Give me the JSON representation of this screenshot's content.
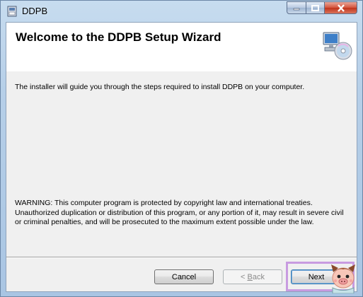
{
  "window": {
    "title": "DDPB"
  },
  "banner": {
    "title": "Welcome to the DDPB Setup Wizard",
    "icon": "computer-cd-icon"
  },
  "body": {
    "intro": "The installer will guide you through the steps required to install DDPB on your computer.",
    "warning": "WARNING: This computer program is protected by copyright law and international treaties. Unauthorized duplication or distribution of this program, or any portion of it, may result in severe civil or criminal penalties, and will be prosecuted to the maximum extent possible under the law."
  },
  "buttons": {
    "cancel": "Cancel",
    "back_prefix": "< ",
    "back_accel": "B",
    "back_rest": "ack",
    "next": "Next"
  },
  "colors": {
    "highlight": "#c89be0",
    "close": "#c0341b"
  }
}
